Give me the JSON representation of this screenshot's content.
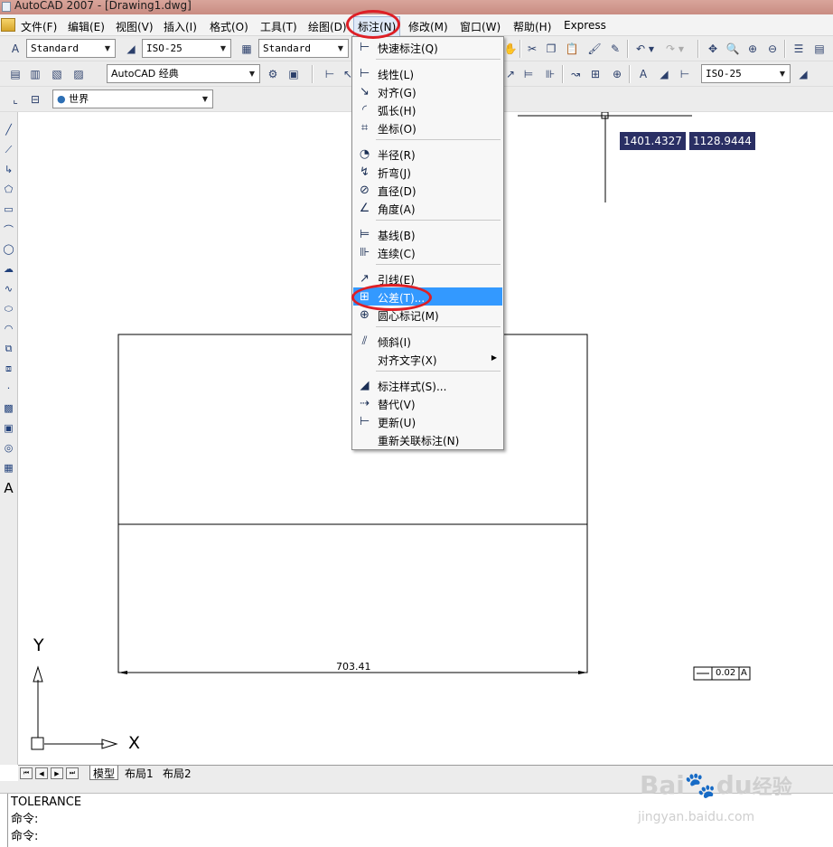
{
  "window": {
    "title": "AutoCAD 2007 - [Drawing1.dwg]"
  },
  "menubar": {
    "items": [
      {
        "label": "文件(F)"
      },
      {
        "label": "编辑(E)"
      },
      {
        "label": "视图(V)"
      },
      {
        "label": "插入(I)"
      },
      {
        "label": "格式(O)"
      },
      {
        "label": "工具(T)"
      },
      {
        "label": "绘图(D)"
      },
      {
        "label": "标注(N)"
      },
      {
        "label": "修改(M)"
      },
      {
        "label": "窗口(W)"
      },
      {
        "label": "帮助(H)"
      },
      {
        "label": "Express"
      }
    ]
  },
  "toolbar": {
    "text_style": "Standard",
    "dim_style": "ISO-25",
    "table_style": "Standard",
    "workspace": "AutoCAD 经典",
    "dim_style_right": "ISO-25",
    "ucs": "世界"
  },
  "dimension_menu": {
    "items": [
      {
        "label": "快速标注(Q)",
        "icon": "quick-dim-icon"
      },
      {
        "label": "线性(L)",
        "icon": "linear-dim-icon"
      },
      {
        "label": "对齐(G)",
        "icon": "aligned-dim-icon"
      },
      {
        "label": "弧长(H)",
        "icon": "arc-length-icon"
      },
      {
        "label": "坐标(O)",
        "icon": "ordinate-icon"
      },
      {
        "label": "半径(R)",
        "icon": "radius-icon"
      },
      {
        "label": "折弯(J)",
        "icon": "jogged-icon"
      },
      {
        "label": "直径(D)",
        "icon": "diameter-icon"
      },
      {
        "label": "角度(A)",
        "icon": "angular-icon"
      },
      {
        "label": "基线(B)",
        "icon": "baseline-icon"
      },
      {
        "label": "连续(C)",
        "icon": "continue-icon"
      },
      {
        "label": "引线(E)",
        "icon": "leader-icon"
      },
      {
        "label": "公差(T)...",
        "icon": "tolerance-icon",
        "highlighted": true
      },
      {
        "label": "圆心标记(M)",
        "icon": "center-mark-icon"
      },
      {
        "label": "倾斜(I)",
        "icon": "oblique-icon"
      },
      {
        "label": "对齐文字(X)",
        "icon": "",
        "submenu": true
      },
      {
        "label": "标注样式(S)...",
        "icon": "dim-style-icon"
      },
      {
        "label": "替代(V)",
        "icon": "override-icon"
      },
      {
        "label": "更新(U)",
        "icon": "update-icon"
      },
      {
        "label": "重新关联标注(N)",
        "icon": ""
      }
    ]
  },
  "canvas": {
    "coord_x": "1401.4327",
    "coord_y": "1128.9444",
    "dimension_text": "703.41",
    "tolerance_value": "0.02",
    "tolerance_datum": "A",
    "axis_y": "Y",
    "axis_x": "X"
  },
  "layout_tabs": [
    {
      "label": "模型",
      "active": true
    },
    {
      "label": "布局1",
      "active": false
    },
    {
      "label": "布局2",
      "active": false
    }
  ],
  "command_line": {
    "lines": [
      "TOLERANCE",
      "命令:",
      "命令:"
    ]
  },
  "watermark": {
    "brand": "Bai",
    "brand2": "du",
    "brand_cn": "经验",
    "url": "jingyan.baidu.com"
  },
  "colors": {
    "highlight": "#3399ff",
    "annotation_circle": "#dd1f26",
    "coord_box": "#2a2f64"
  }
}
